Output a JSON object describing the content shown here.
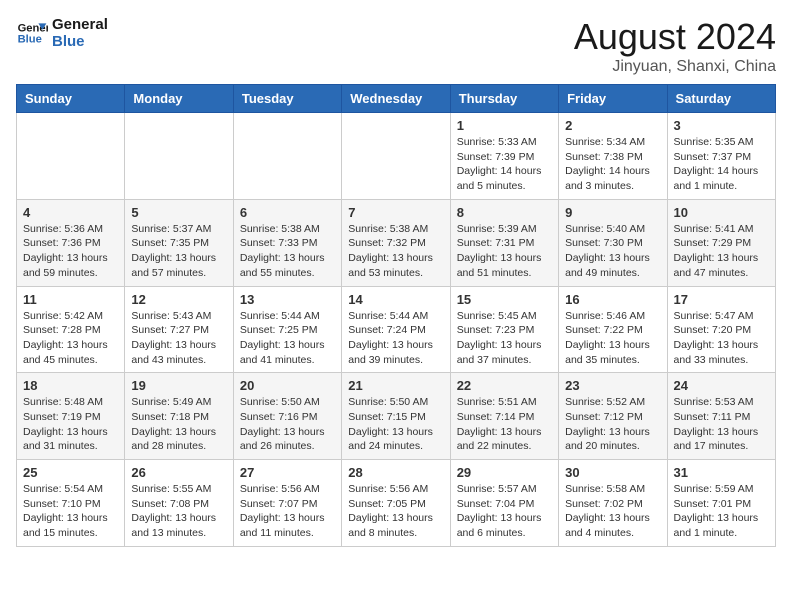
{
  "logo": {
    "line1": "General",
    "line2": "Blue"
  },
  "title": "August 2024",
  "location": "Jinyuan, Shanxi, China",
  "days_of_week": [
    "Sunday",
    "Monday",
    "Tuesday",
    "Wednesday",
    "Thursday",
    "Friday",
    "Saturday"
  ],
  "weeks": [
    [
      {
        "day": "",
        "info": ""
      },
      {
        "day": "",
        "info": ""
      },
      {
        "day": "",
        "info": ""
      },
      {
        "day": "",
        "info": ""
      },
      {
        "day": "1",
        "info": "Sunrise: 5:33 AM\nSunset: 7:39 PM\nDaylight: 14 hours\nand 5 minutes."
      },
      {
        "day": "2",
        "info": "Sunrise: 5:34 AM\nSunset: 7:38 PM\nDaylight: 14 hours\nand 3 minutes."
      },
      {
        "day": "3",
        "info": "Sunrise: 5:35 AM\nSunset: 7:37 PM\nDaylight: 14 hours\nand 1 minute."
      }
    ],
    [
      {
        "day": "4",
        "info": "Sunrise: 5:36 AM\nSunset: 7:36 PM\nDaylight: 13 hours\nand 59 minutes."
      },
      {
        "day": "5",
        "info": "Sunrise: 5:37 AM\nSunset: 7:35 PM\nDaylight: 13 hours\nand 57 minutes."
      },
      {
        "day": "6",
        "info": "Sunrise: 5:38 AM\nSunset: 7:33 PM\nDaylight: 13 hours\nand 55 minutes."
      },
      {
        "day": "7",
        "info": "Sunrise: 5:38 AM\nSunset: 7:32 PM\nDaylight: 13 hours\nand 53 minutes."
      },
      {
        "day": "8",
        "info": "Sunrise: 5:39 AM\nSunset: 7:31 PM\nDaylight: 13 hours\nand 51 minutes."
      },
      {
        "day": "9",
        "info": "Sunrise: 5:40 AM\nSunset: 7:30 PM\nDaylight: 13 hours\nand 49 minutes."
      },
      {
        "day": "10",
        "info": "Sunrise: 5:41 AM\nSunset: 7:29 PM\nDaylight: 13 hours\nand 47 minutes."
      }
    ],
    [
      {
        "day": "11",
        "info": "Sunrise: 5:42 AM\nSunset: 7:28 PM\nDaylight: 13 hours\nand 45 minutes."
      },
      {
        "day": "12",
        "info": "Sunrise: 5:43 AM\nSunset: 7:27 PM\nDaylight: 13 hours\nand 43 minutes."
      },
      {
        "day": "13",
        "info": "Sunrise: 5:44 AM\nSunset: 7:25 PM\nDaylight: 13 hours\nand 41 minutes."
      },
      {
        "day": "14",
        "info": "Sunrise: 5:44 AM\nSunset: 7:24 PM\nDaylight: 13 hours\nand 39 minutes."
      },
      {
        "day": "15",
        "info": "Sunrise: 5:45 AM\nSunset: 7:23 PM\nDaylight: 13 hours\nand 37 minutes."
      },
      {
        "day": "16",
        "info": "Sunrise: 5:46 AM\nSunset: 7:22 PM\nDaylight: 13 hours\nand 35 minutes."
      },
      {
        "day": "17",
        "info": "Sunrise: 5:47 AM\nSunset: 7:20 PM\nDaylight: 13 hours\nand 33 minutes."
      }
    ],
    [
      {
        "day": "18",
        "info": "Sunrise: 5:48 AM\nSunset: 7:19 PM\nDaylight: 13 hours\nand 31 minutes."
      },
      {
        "day": "19",
        "info": "Sunrise: 5:49 AM\nSunset: 7:18 PM\nDaylight: 13 hours\nand 28 minutes."
      },
      {
        "day": "20",
        "info": "Sunrise: 5:50 AM\nSunset: 7:16 PM\nDaylight: 13 hours\nand 26 minutes."
      },
      {
        "day": "21",
        "info": "Sunrise: 5:50 AM\nSunset: 7:15 PM\nDaylight: 13 hours\nand 24 minutes."
      },
      {
        "day": "22",
        "info": "Sunrise: 5:51 AM\nSunset: 7:14 PM\nDaylight: 13 hours\nand 22 minutes."
      },
      {
        "day": "23",
        "info": "Sunrise: 5:52 AM\nSunset: 7:12 PM\nDaylight: 13 hours\nand 20 minutes."
      },
      {
        "day": "24",
        "info": "Sunrise: 5:53 AM\nSunset: 7:11 PM\nDaylight: 13 hours\nand 17 minutes."
      }
    ],
    [
      {
        "day": "25",
        "info": "Sunrise: 5:54 AM\nSunset: 7:10 PM\nDaylight: 13 hours\nand 15 minutes."
      },
      {
        "day": "26",
        "info": "Sunrise: 5:55 AM\nSunset: 7:08 PM\nDaylight: 13 hours\nand 13 minutes."
      },
      {
        "day": "27",
        "info": "Sunrise: 5:56 AM\nSunset: 7:07 PM\nDaylight: 13 hours\nand 11 minutes."
      },
      {
        "day": "28",
        "info": "Sunrise: 5:56 AM\nSunset: 7:05 PM\nDaylight: 13 hours\nand 8 minutes."
      },
      {
        "day": "29",
        "info": "Sunrise: 5:57 AM\nSunset: 7:04 PM\nDaylight: 13 hours\nand 6 minutes."
      },
      {
        "day": "30",
        "info": "Sunrise: 5:58 AM\nSunset: 7:02 PM\nDaylight: 13 hours\nand 4 minutes."
      },
      {
        "day": "31",
        "info": "Sunrise: 5:59 AM\nSunset: 7:01 PM\nDaylight: 13 hours\nand 1 minute."
      }
    ]
  ]
}
